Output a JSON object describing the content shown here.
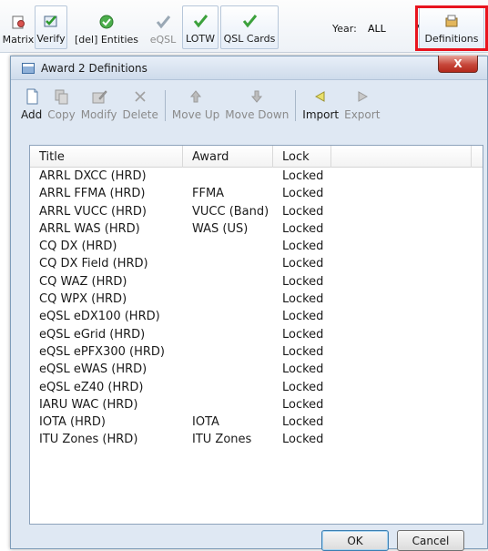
{
  "ribbon": {
    "matrix_label": "Matrix",
    "verify_label": "Verify",
    "entities_label": "[del] Entities",
    "eqsl_label": "eQSL",
    "lotw_label": "LOTW",
    "qsl_cards_label": "QSL Cards",
    "year_label": "Year:",
    "year_value": "ALL",
    "definitions_label": "Definitions",
    "highlight_color": "#e8141e"
  },
  "dialog": {
    "title": "Award 2 Definitions",
    "close_glyph": "X",
    "toolbar": {
      "add": "Add",
      "copy": "Copy",
      "modify": "Modify",
      "delete": "Delete",
      "move_up": "Move Up",
      "move_down": "Move Down",
      "import": "Import",
      "export": "Export"
    },
    "columns": [
      "Title",
      "Award",
      "Lock",
      ""
    ],
    "rows": [
      {
        "title": "ARRL DXCC (HRD)",
        "award": "",
        "lock": "Locked"
      },
      {
        "title": "ARRL FFMA (HRD)",
        "award": "FFMA",
        "lock": "Locked"
      },
      {
        "title": "ARRL VUCC (HRD)",
        "award": "VUCC (Band)",
        "lock": "Locked"
      },
      {
        "title": "ARRL WAS (HRD)",
        "award": "WAS (US)",
        "lock": "Locked"
      },
      {
        "title": "CQ DX (HRD)",
        "award": "",
        "lock": "Locked"
      },
      {
        "title": "CQ DX Field (HRD)",
        "award": "",
        "lock": "Locked"
      },
      {
        "title": "CQ WAZ (HRD)",
        "award": "",
        "lock": "Locked"
      },
      {
        "title": "CQ WPX (HRD)",
        "award": "",
        "lock": "Locked"
      },
      {
        "title": "eQSL eDX100 (HRD)",
        "award": "",
        "lock": "Locked"
      },
      {
        "title": "eQSL eGrid (HRD)",
        "award": "",
        "lock": "Locked"
      },
      {
        "title": "eQSL ePFX300 (HRD)",
        "award": "",
        "lock": "Locked"
      },
      {
        "title": "eQSL eWAS (HRD)",
        "award": "",
        "lock": "Locked"
      },
      {
        "title": "eQSL eZ40 (HRD)",
        "award": "",
        "lock": "Locked"
      },
      {
        "title": "IARU WAC (HRD)",
        "award": "",
        "lock": "Locked"
      },
      {
        "title": "IOTA (HRD)",
        "award": "IOTA",
        "lock": "Locked"
      },
      {
        "title": "ITU Zones (HRD)",
        "award": "ITU Zones",
        "lock": "Locked"
      }
    ],
    "ok_label": "OK",
    "cancel_label": "Cancel"
  }
}
